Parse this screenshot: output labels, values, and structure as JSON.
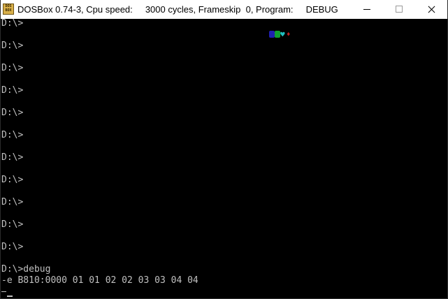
{
  "window": {
    "title": "DOSBox 0.74-3, Cpu speed:     3000 cycles, Frameskip  0, Program:     DEBUG",
    "icon_name": "dosbox-icon",
    "icon_text_top": "DOS",
    "icon_text_bottom": "BOX",
    "buttons": {
      "minimize": "minimize-icon",
      "maximize": "maximize-icon",
      "close": "close-icon"
    }
  },
  "terminal": {
    "background": "#000000",
    "text_color": "#c0c0c0",
    "lines": [
      "D:\\>",
      "D:\\>",
      "D:\\>",
      "D:\\>",
      "D:\\>",
      "D:\\>",
      "D:\\>",
      "D:\\>",
      "D:\\>",
      "D:\\>",
      "D:\\>",
      "D:\\>debug",
      "-e B810:0000 01 01 02 02 03 03 04 04"
    ],
    "current_prompt": "-",
    "memory_glyphs": {
      "colors": [
        "#2020b0",
        "#10a030",
        "#20c0c0",
        "#c02020"
      ],
      "chars": [
        "☺",
        "☻",
        "♥",
        "♦"
      ]
    }
  }
}
